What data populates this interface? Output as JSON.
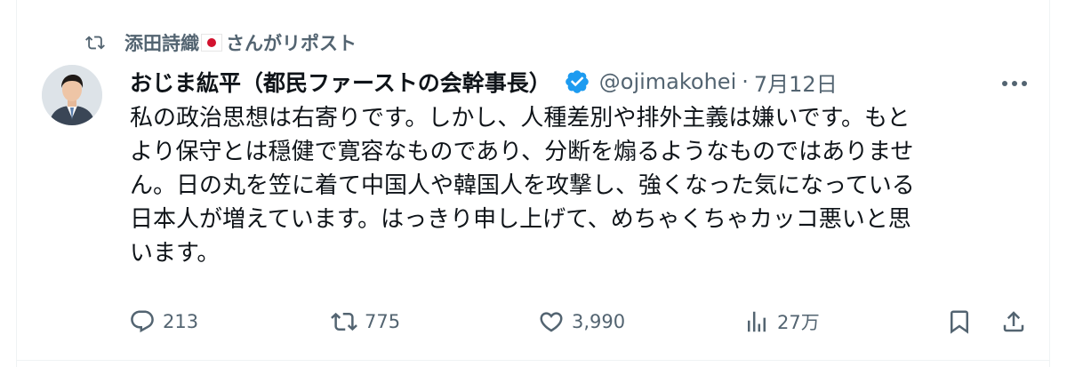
{
  "repost": {
    "name": "添田詩織",
    "suffix": "さんがリポスト",
    "icon": "repost-icon",
    "flag": "japan-flag"
  },
  "author": {
    "display_name": "おじま紘平（都民ファーストの会幹事長）",
    "handle": "@ojimakohei",
    "separator": "·",
    "date": "7月12日",
    "verified_color": "#1d9bf0"
  },
  "tweet": {
    "lines": [
      "私の政治思想は右寄りです。しかし、人種差別や排外主義は嫌いです。もと",
      "より保守とは穏健で寛容なものであり、分断を煽るようなものではありませ",
      "ん。日の丸を笠に着て中国人や韓国人を攻撃し、強くなった気になっている",
      "日本人が増えています。はっきり申し上げて、めちゃくちゃカッコ悪いと思",
      "います。"
    ]
  },
  "actions": {
    "reply_count": "213",
    "repost_count": "775",
    "like_count": "3,990",
    "view_count": "27万"
  },
  "colors": {
    "text": "#0f1419",
    "secondary": "#536471",
    "border": "#eff3f4",
    "accent": "#1d9bf0"
  }
}
